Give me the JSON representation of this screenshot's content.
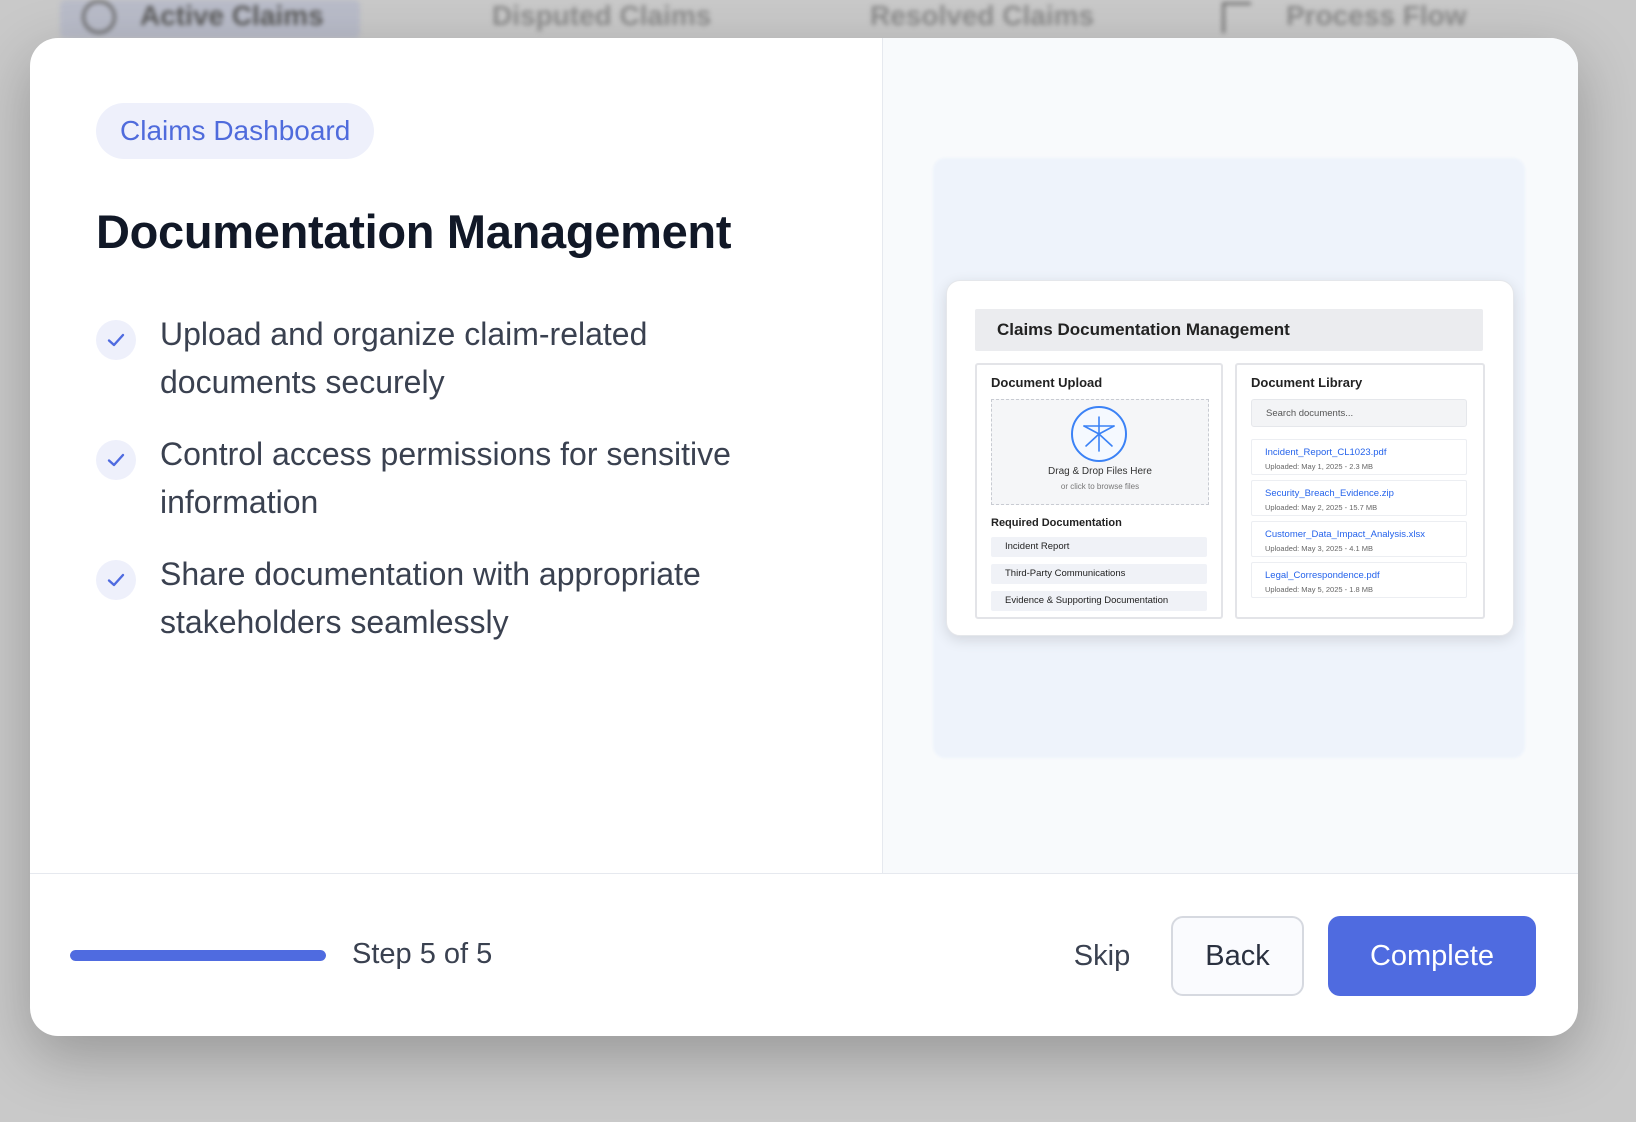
{
  "background_tabs": [
    {
      "label": "Active Claims",
      "icon": "clock-icon"
    },
    {
      "label": "Disputed Claims"
    },
    {
      "label": "Resolved Claims"
    },
    {
      "label": "Process Flow",
      "icon": "flow-icon"
    }
  ],
  "modal": {
    "badge": "Claims Dashboard",
    "title": "Documentation Management",
    "features": [
      "Upload and organize claim-related documents securely",
      "Control access permissions for sensitive information",
      "Share documentation with appropriate stakeholders seamlessly"
    ]
  },
  "preview": {
    "header": "Claims Documentation Management",
    "upload": {
      "title": "Document Upload",
      "drop_main": "Drag & Drop Files Here",
      "drop_sub": "or click to browse files",
      "required_title": "Required Documentation",
      "required_items": [
        "Incident Report",
        "Third-Party Communications",
        "Evidence & Supporting Documentation"
      ]
    },
    "library": {
      "title": "Document Library",
      "search_placeholder": "Search documents...",
      "documents": [
        {
          "name": "Incident_Report_CL1023.pdf",
          "meta": "Uploaded: May 1, 2025 - 2.3 MB"
        },
        {
          "name": "Security_Breach_Evidence.zip",
          "meta": "Uploaded: May 2, 2025 - 15.7 MB"
        },
        {
          "name": "Customer_Data_Impact_Analysis.xlsx",
          "meta": "Uploaded: May 3, 2025 - 4.1 MB"
        },
        {
          "name": "Legal_Correspondence.pdf",
          "meta": "Uploaded: May 5, 2025 - 1.8 MB"
        }
      ]
    }
  },
  "footer": {
    "progress_fraction": 1.0,
    "step_text": "Step 5 of 5",
    "skip_label": "Skip",
    "back_label": "Back",
    "complete_label": "Complete"
  },
  "colors": {
    "accent": "#4f6be0",
    "badge_bg": "#eef0fb",
    "link": "#2563eb"
  }
}
